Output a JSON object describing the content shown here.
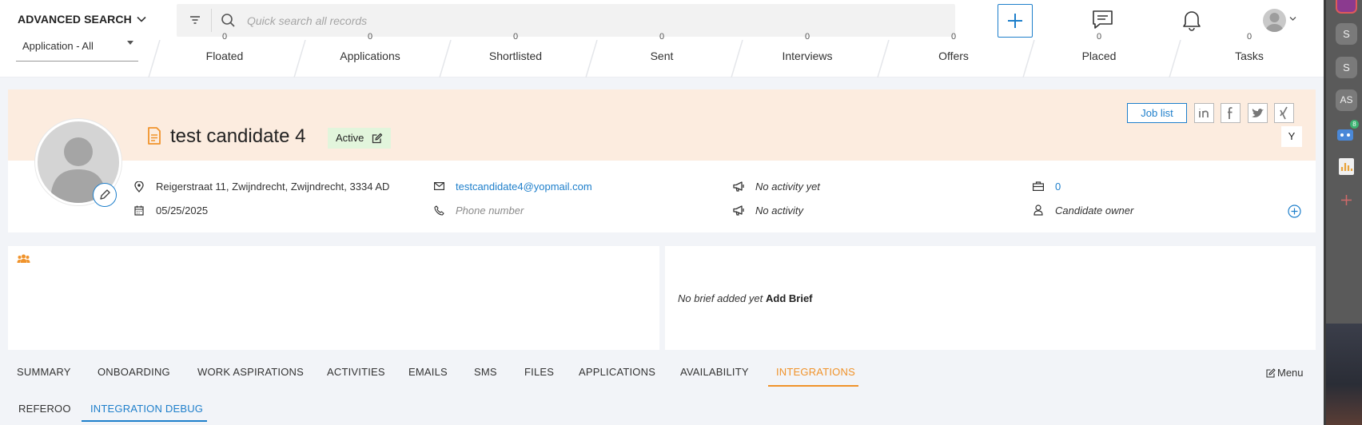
{
  "topbar": {
    "advanced_search": "ADVANCED SEARCH",
    "search_placeholder": "Quick search all records"
  },
  "dock": {
    "items": [
      "S",
      "S",
      "AS"
    ],
    "badge": "8"
  },
  "stages": {
    "application_filter": "Application - All",
    "items": [
      {
        "label": "Floated",
        "count": "0"
      },
      {
        "label": "Applications",
        "count": "0"
      },
      {
        "label": "Shortlisted",
        "count": "0"
      },
      {
        "label": "Sent",
        "count": "0"
      },
      {
        "label": "Interviews",
        "count": "0"
      },
      {
        "label": "Offers",
        "count": "0"
      },
      {
        "label": "Placed",
        "count": "0"
      },
      {
        "label": "Tasks",
        "count": "0"
      }
    ]
  },
  "candidate": {
    "name": "test candidate 4",
    "status": "Active",
    "job_list": "Job list",
    "y_label": "Y",
    "address": "Reigerstraat 11, Zwijndrecht, Zwijndrecht, 3334 AD",
    "date": "05/25/2025",
    "email": "testcandidate4@yopmail.com",
    "phone_placeholder": "Phone number",
    "activity_1": "No activity yet",
    "activity_2": "No activity",
    "jobs_count": "0",
    "owner": "Candidate owner"
  },
  "brief": {
    "empty_text": "No brief added yet",
    "add_label": "Add Brief"
  },
  "tabs": {
    "items": [
      "SUMMARY",
      "ONBOARDING",
      "WORK ASPIRATIONS",
      "ACTIVITIES",
      "EMAILS",
      "SMS",
      "FILES",
      "APPLICATIONS",
      "AVAILABILITY",
      "INTEGRATIONS"
    ],
    "active": "INTEGRATIONS",
    "menu_label": "Menu"
  },
  "subtabs": {
    "items": [
      "REFEROO",
      "INTEGRATION DEBUG"
    ],
    "active": "INTEGRATION DEBUG"
  },
  "colors": {
    "accent_blue": "#1e7fcb",
    "accent_orange": "#f0932b",
    "header_bg": "#fcecdf",
    "status_bg": "#e2f5dc"
  }
}
